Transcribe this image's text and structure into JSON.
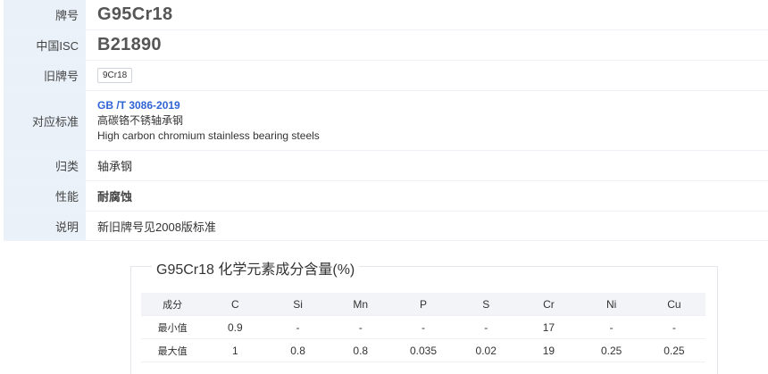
{
  "info": {
    "grade": {
      "label": "牌号",
      "value": "G95Cr18"
    },
    "isc": {
      "label": "中国ISC",
      "value": "B21890"
    },
    "old_grade": {
      "label": "旧牌号",
      "value": "9Cr18"
    },
    "standard": {
      "label": "对应标准",
      "code": "GB /T 3086-2019",
      "name_cn": "高碳铬不锈轴承钢",
      "name_en": "High carbon chromium stainless bearing steels"
    },
    "category": {
      "label": "归类",
      "value": "轴承钢"
    },
    "property": {
      "label": "性能",
      "value": "耐腐蚀"
    },
    "note": {
      "label": "说明",
      "value": "新旧牌号见2008版标准"
    }
  },
  "chemistry": {
    "title": "G95Cr18 化学元素成分含量(%)",
    "header_label": "成分",
    "elements": [
      "C",
      "Si",
      "Mn",
      "P",
      "S",
      "Cr",
      "Ni",
      "Cu"
    ],
    "rows": [
      {
        "label": "最小值",
        "values": [
          "0.9",
          "-",
          "-",
          "-",
          "-",
          "17",
          "-",
          "-"
        ]
      },
      {
        "label": "最大值",
        "values": [
          "1",
          "0.8",
          "0.8",
          "0.035",
          "0.02",
          "19",
          "0.25",
          "0.25"
        ]
      }
    ]
  }
}
